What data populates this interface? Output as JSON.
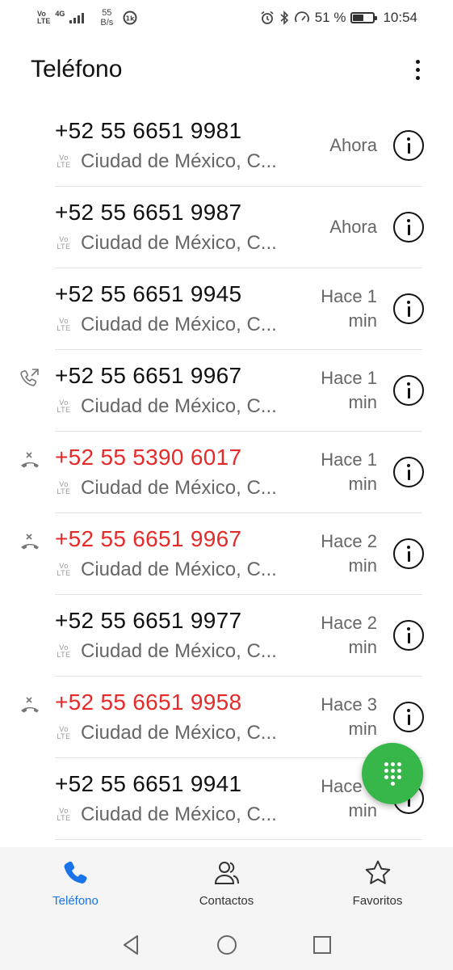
{
  "status_bar": {
    "net_type": "4G",
    "volte_top": "Vo",
    "volte_bottom": "LTE",
    "net_speed_value": "55",
    "net_speed_unit": "B/s",
    "battery_percent": "51 %",
    "battery_level": 0.51,
    "time": "10:54"
  },
  "header": {
    "title": "Teléfono"
  },
  "calls": [
    {
      "number": "+52 55 6651 9981",
      "location": "Ciudad de México, C...",
      "time": "Ahora",
      "type": "incoming",
      "missed": false
    },
    {
      "number": "+52 55 6651 9987",
      "location": "Ciudad de México, C...",
      "time": "Ahora",
      "type": "incoming",
      "missed": false
    },
    {
      "number": "+52 55 6651 9945",
      "location": "Ciudad de México, C...",
      "time": "Hace 1 min",
      "type": "incoming",
      "missed": false
    },
    {
      "number": "+52 55 6651 9967",
      "location": "Ciudad de México, C...",
      "time": "Hace 1 min",
      "type": "outgoing",
      "missed": false
    },
    {
      "number": "+52 55 5390 6017",
      "location": "Ciudad de México, C...",
      "time": "Hace 1 min",
      "type": "missed",
      "missed": true
    },
    {
      "number": "+52 55 6651 9967",
      "location": "Ciudad de México, C...",
      "time": "Hace 2 min",
      "type": "missed",
      "missed": true
    },
    {
      "number": "+52 55 6651 9977",
      "location": "Ciudad de México, C...",
      "time": "Hace 2 min",
      "type": "incoming",
      "missed": false
    },
    {
      "number": "+52 55 6651 9958",
      "location": "Ciudad de México, C...",
      "time": "Hace 3 min",
      "type": "missed",
      "missed": true
    },
    {
      "number": "+52 55 6651 9941",
      "location": "Ciudad de México, C...",
      "time": "Hace 4 min",
      "type": "incoming",
      "missed": false
    }
  ],
  "volte_badge": {
    "top": "Vo",
    "bottom": "LTE"
  },
  "bottom_nav": {
    "phone": "Teléfono",
    "contacts": "Contactos",
    "favorites": "Favoritos"
  },
  "colors": {
    "accent": "#1a73e8",
    "missed": "#e52a2a",
    "fab": "#37b64a"
  },
  "icons": {
    "fab": "dialpad-icon",
    "row_action": "info-icon",
    "outgoing": "outgoing-call-icon",
    "missed": "missed-call-icon"
  }
}
